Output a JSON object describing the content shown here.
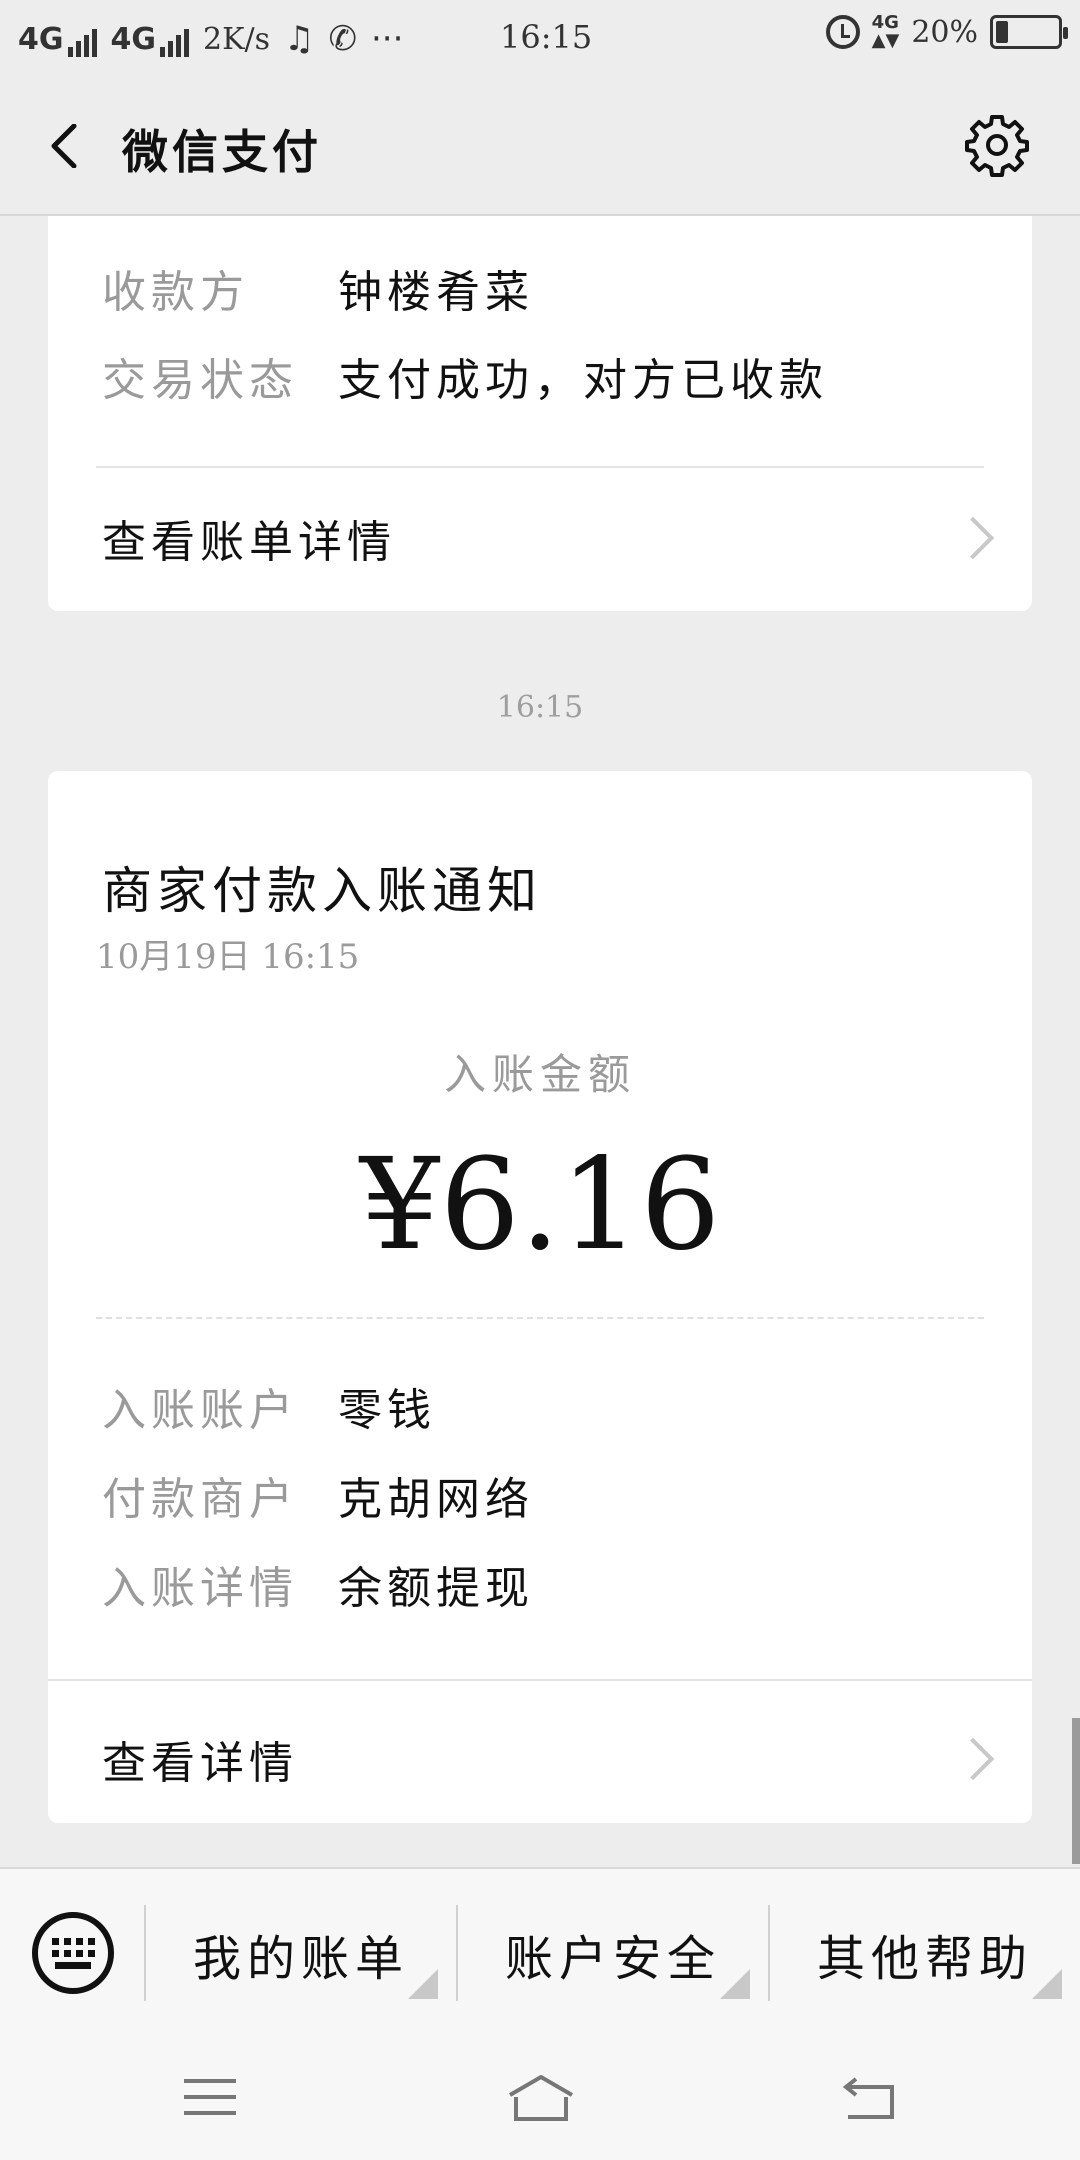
{
  "status_bar": {
    "network1": "4G",
    "network2": "4G",
    "speed": "2K/s",
    "time": "16:15",
    "net_small": "4G",
    "battery": "20%",
    "battery_level": 0.2
  },
  "header": {
    "title": "微信支付"
  },
  "card1": {
    "payee_label": "收款方",
    "payee_value": "钟楼肴菜",
    "status_label": "交易状态",
    "status_value": "支付成功，对方已收款",
    "link_label": "查看账单详情"
  },
  "time_separator": "16:15",
  "card2": {
    "title": "商家付款入账通知",
    "date": "10月19日  16:15",
    "amount_label": "入账金额",
    "amount": "¥6.16",
    "rows": [
      {
        "label": "入账账户",
        "value": "零钱"
      },
      {
        "label": "付款商户",
        "value": "克胡网络"
      },
      {
        "label": "入账详情",
        "value": "余额提现"
      }
    ],
    "link_label": "查看详情"
  },
  "bottom_menu": {
    "items": [
      "我的账单",
      "账户安全",
      "其他帮助"
    ]
  },
  "icons": {
    "back": "back-arrow-icon",
    "settings": "gear-icon",
    "keyboard": "keyboard-icon",
    "nav_menu": "menu-icon",
    "nav_home": "home-icon",
    "nav_back": "back-icon"
  }
}
